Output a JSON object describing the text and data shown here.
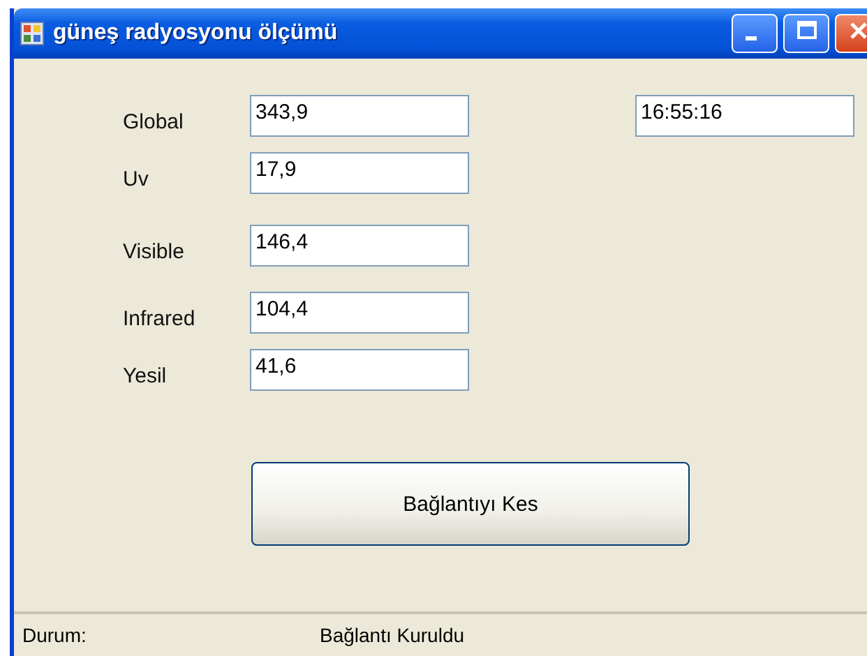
{
  "window": {
    "title": "güneş radyosyonu ölçümü"
  },
  "readings": [
    {
      "label": "Global",
      "value": "343,9"
    },
    {
      "label": "Uv",
      "value": "17,9"
    },
    {
      "label": "Visible",
      "value": "146,4"
    },
    {
      "label": "Infrared",
      "value": "104,4"
    },
    {
      "label": "Yesil",
      "value": "41,6"
    }
  ],
  "time": {
    "value": "16:55:16"
  },
  "button": {
    "label": "Bağlantıyı Kes"
  },
  "status_bar": {
    "label": "Durum:",
    "value": "Bağlantı Kuruldu"
  }
}
